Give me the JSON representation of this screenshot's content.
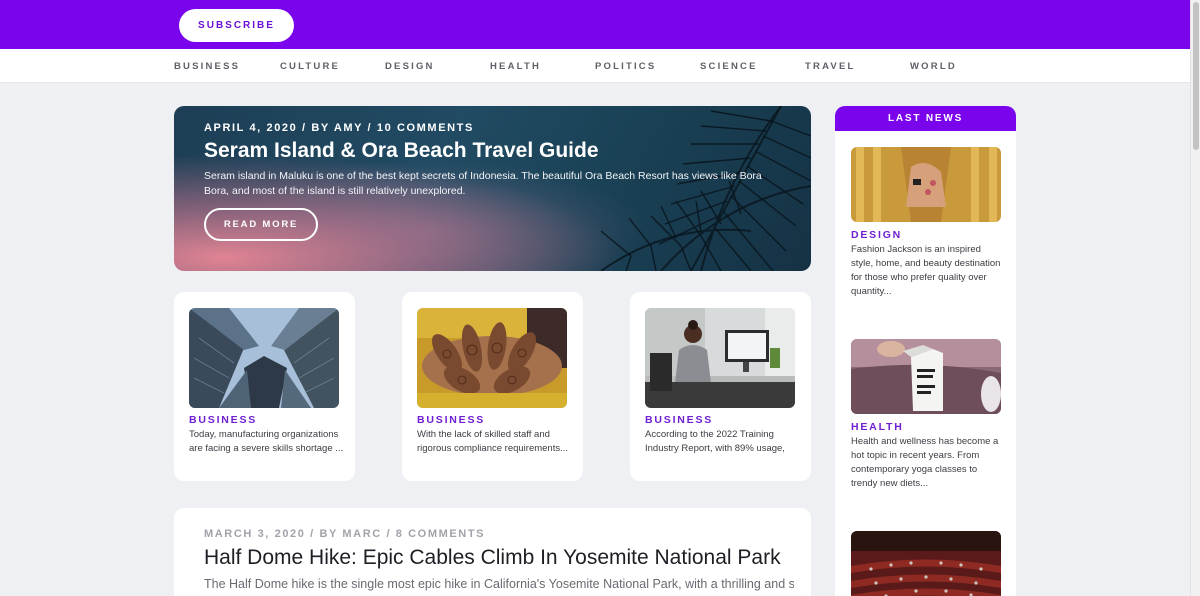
{
  "header": {
    "subscribe_label": "SUBSCRIBE"
  },
  "nav": {
    "items": [
      {
        "label": "BUSINESS"
      },
      {
        "label": "CULTURE"
      },
      {
        "label": "DESIGN"
      },
      {
        "label": "HEALTH"
      },
      {
        "label": "POLITICS"
      },
      {
        "label": "SCIENCE"
      },
      {
        "label": "TRAVEL"
      },
      {
        "label": "WORLD"
      }
    ]
  },
  "hero": {
    "meta": "APRIL 4, 2020 / BY AMY / 10 COMMENTS",
    "title": "Seram Island & Ora Beach Travel Guide",
    "excerpt": "Seram island in Maluku is one of the best kept secrets of Indonesia. The beautiful Ora Beach Resort has views like Bora Bora, and most of the island is still relatively unexplored.",
    "button_label": "READ MORE"
  },
  "cards": [
    {
      "category": "BUSINESS",
      "excerpt": "Today, manufacturing organizations are facing a severe skills shortage ...",
      "image": "skyscrapers-photo"
    },
    {
      "category": "BUSINESS",
      "excerpt": "With the lack of skilled staff and rigorous compliance requirements...",
      "image": "henna-hands-photo"
    },
    {
      "category": "BUSINESS",
      "excerpt": "According to the 2022 Training Industry Report, with 89% usage,",
      "image": "office-worker-photo"
    }
  ],
  "post": {
    "meta": "MARCH 3, 2020 / BY MARC / 8 COMMENTS",
    "title": "Half Dome Hike: Epic Cables Climb In Yosemite National Park",
    "excerpt": "The Half Dome hike is the single most epic hike in California's Yosemite National Park, with a thrilling and scary"
  },
  "sidebar": {
    "title": "LAST NEWS",
    "items": [
      {
        "category": "DESIGN",
        "excerpt": "Fashion Jackson is an inspired style, home, and beauty destination for those who prefer quality over quantity...",
        "image": "fashion-photo"
      },
      {
        "category": "HEALTH",
        "excerpt": "Health and wellness has become a hot topic in recent years. From contemporary yoga classes to trendy new diets...",
        "image": "yoga-photo"
      },
      {
        "category": "",
        "excerpt": "",
        "image": "parliament-photo"
      }
    ]
  },
  "colors": {
    "brand": "#7a04ec",
    "category": "#6f1fd2",
    "background": "#eef0f4"
  }
}
